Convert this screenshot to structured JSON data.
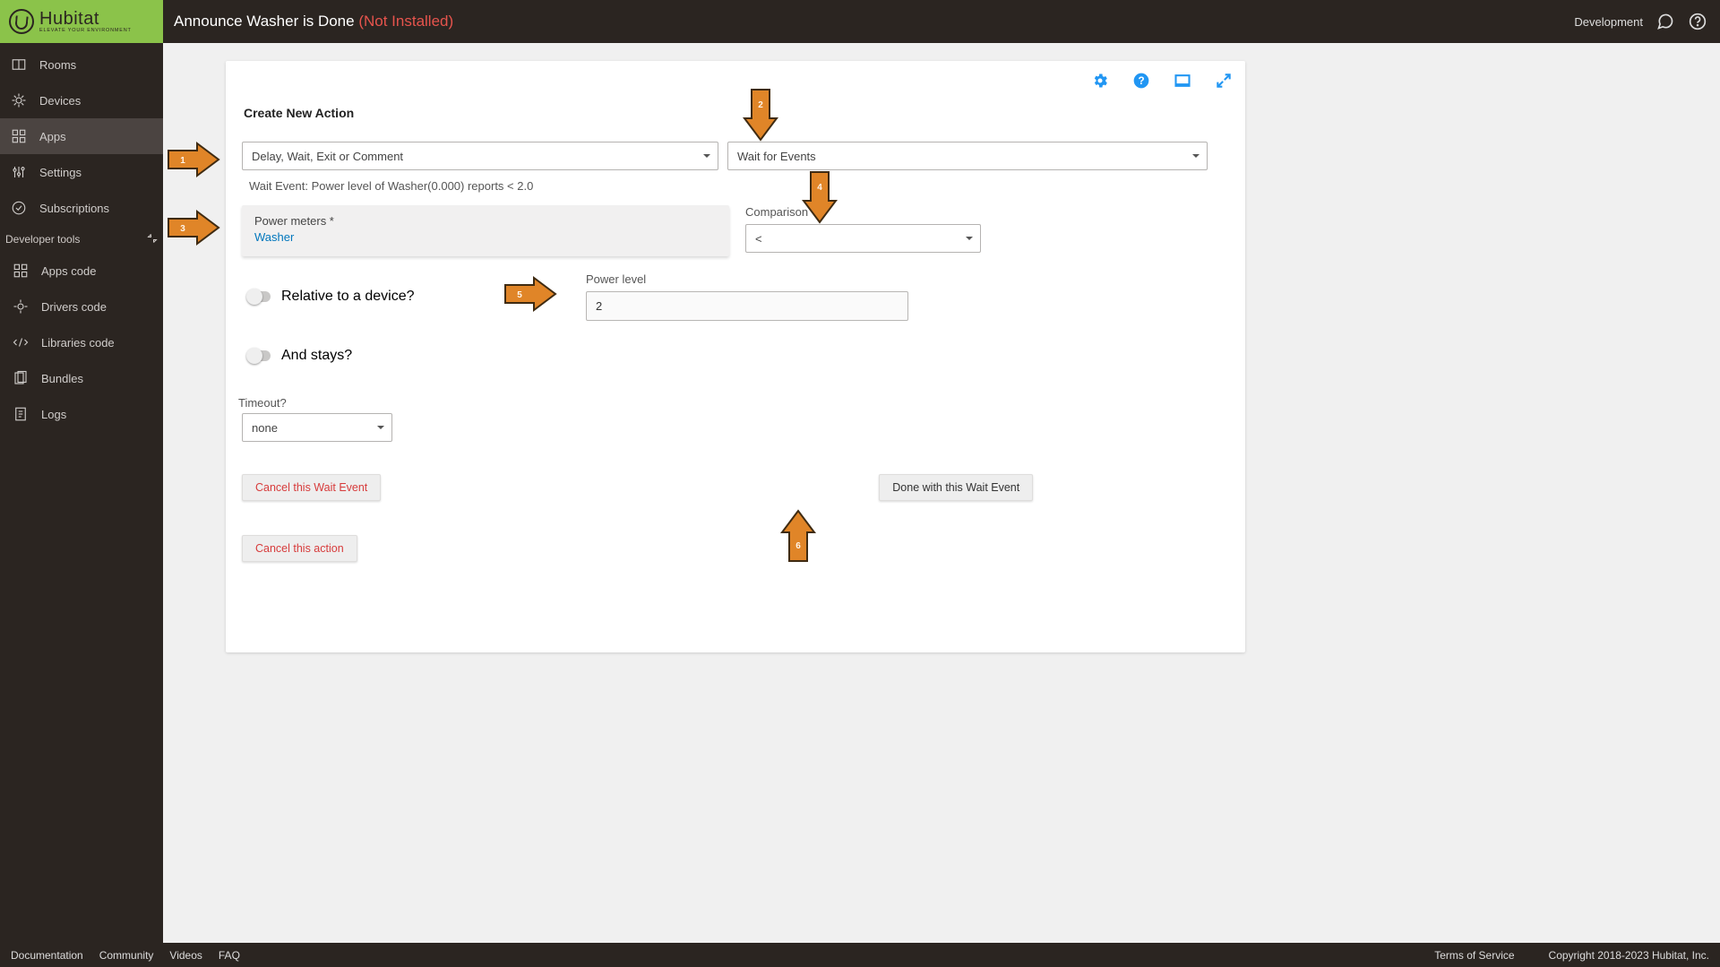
{
  "brand": {
    "name": "Hubitat",
    "tagline": "ELEVATE YOUR ENVIRONMENT"
  },
  "header": {
    "page_title": "Announce Washer is Done",
    "status_suffix": "(Not Installed)",
    "env_label": "Development"
  },
  "sidebar": {
    "items": [
      {
        "label": "Rooms"
      },
      {
        "label": "Devices"
      },
      {
        "label": "Apps"
      },
      {
        "label": "Settings"
      },
      {
        "label": "Subscriptions"
      }
    ],
    "dev_header": "Developer tools",
    "dev_items": [
      {
        "label": "Apps code"
      },
      {
        "label": "Drivers code"
      },
      {
        "label": "Libraries code"
      },
      {
        "label": "Bundles"
      },
      {
        "label": "Logs"
      }
    ]
  },
  "form": {
    "heading": "Create New Action",
    "action_category": "Delay, Wait, Exit or Comment",
    "action_sub": "Wait for Events",
    "wait_summary": "Wait Event: Power level of Washer(0.000) reports < 2.0",
    "power_meters_label": "Power meters *",
    "power_meters_value": "Washer",
    "comparison_label": "Comparison *",
    "comparison_value": "<",
    "relative_label": "Relative to a device?",
    "power_level_label": "Power level",
    "power_level_value": "2",
    "and_stays_label": "And stays?",
    "timeout_label": "Timeout?",
    "timeout_value": "none",
    "cancel_wait": "Cancel this Wait Event",
    "done_wait": "Done with this Wait Event",
    "cancel_action": "Cancel this action"
  },
  "arrows": {
    "1": "1",
    "2": "2",
    "3": "3",
    "4": "4",
    "5": "5",
    "6": "6"
  },
  "footer": {
    "links": [
      "Documentation",
      "Community",
      "Videos",
      "FAQ"
    ],
    "tos": "Terms of Service",
    "copyright": "Copyright 2018-2023 Hubitat, Inc."
  }
}
